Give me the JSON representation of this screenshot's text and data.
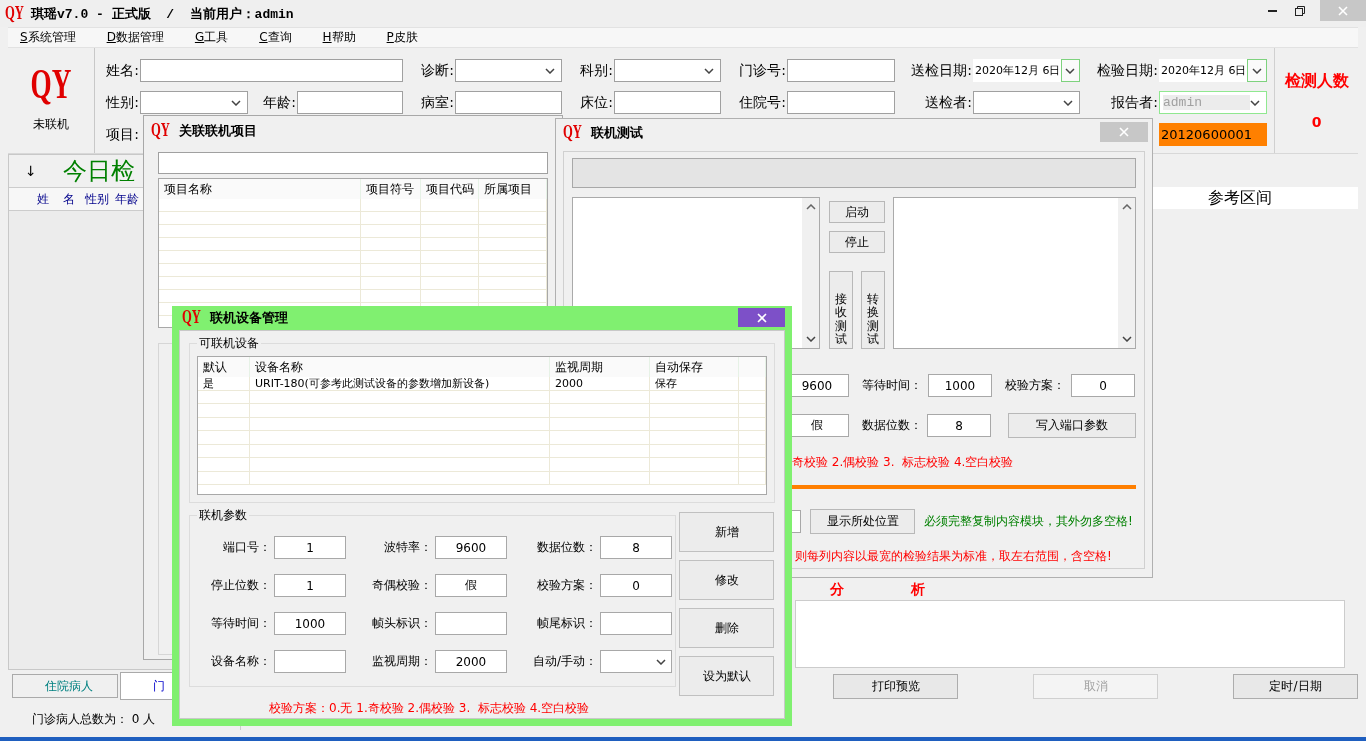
{
  "window": {
    "logo": "QY",
    "title": "琪瑶v7.0 - 正式版  /  当前用户：admin"
  },
  "menu": [
    {
      "key": "S",
      "label": "系统管理"
    },
    {
      "key": "D",
      "label": "数据管理"
    },
    {
      "key": "G",
      "label": "工具"
    },
    {
      "key": "C",
      "label": "查询"
    },
    {
      "key": "H",
      "label": "帮助"
    },
    {
      "key": "P",
      "label": "皮肤"
    }
  ],
  "header": {
    "logo": "QY",
    "connection": "未联机",
    "form": [
      {
        "label": "姓名:",
        "kind": "text"
      },
      {
        "label": "诊断:",
        "kind": "combo"
      },
      {
        "label": "科别:",
        "kind": "combo"
      },
      {
        "label": "门诊号:",
        "kind": "text"
      },
      {
        "label": "送检日期:",
        "kind": "date",
        "value": "2020年12月 6日"
      },
      {
        "label": "检验日期:",
        "kind": "date",
        "value": "2020年12月 6日"
      },
      {
        "label": "性别:",
        "kind": "combo"
      },
      {
        "label": "年龄:",
        "kind": "text"
      },
      {
        "label": "病室:",
        "kind": "text"
      },
      {
        "label": "床位:",
        "kind": "text"
      },
      {
        "label": "住院号:",
        "kind": "text"
      },
      {
        "label": "送检者:",
        "kind": "combo"
      },
      {
        "label": "报告者:",
        "kind": "combo",
        "value": "admin",
        "disabled": true
      }
    ],
    "item_label": "项目:",
    "sample_no": "20120600001",
    "count_label": "检测人数",
    "count": "0"
  },
  "patients": {
    "arrow": "↓",
    "title": "今日检",
    "columns": [
      "姓 名",
      "性别",
      "年龄"
    ]
  },
  "results": {
    "columns": [
      "参考区间"
    ],
    "analysis_title": "分 析"
  },
  "bottom_tabs": [
    {
      "label": "住院病人",
      "selected": false
    },
    {
      "label": "门",
      "selected": true
    }
  ],
  "buttons": [
    {
      "label": "打印预览",
      "disabled": false
    },
    {
      "label": "取消",
      "disabled": true
    },
    {
      "label": "定时/日期",
      "disabled": false
    }
  ],
  "status_bar": "门诊病人总数为： 0 人",
  "item_dialog": {
    "logo": "QY",
    "title": "关联联机项目",
    "columns": [
      "项目名称",
      "项目符号",
      "项目代码",
      "所属项目"
    ]
  },
  "test_dialog": {
    "logo": "QY",
    "title": "联机测试",
    "side_buttons": [
      "启动",
      "停止"
    ],
    "vertical_buttons": [
      "接收测试",
      "转换测试"
    ],
    "rows": [
      [
        {
          "kind": "field",
          "value": "9600"
        },
        {
          "kind": "label",
          "text": "等待时间："
        },
        {
          "kind": "field",
          "value": "1000"
        },
        {
          "kind": "label",
          "text": "校验方案："
        },
        {
          "kind": "field",
          "value": "0"
        }
      ],
      [
        {
          "kind": "field",
          "value": "假"
        },
        {
          "kind": "label",
          "text": "数据位数："
        },
        {
          "kind": "field",
          "value": "8"
        },
        {
          "kind": "button",
          "text": "写入端口参数"
        }
      ]
    ],
    "parity_note": "奇校验 2.偶校验 3.  标志校验 4.空白校验",
    "locate_button": "显示所处位置",
    "copy_note": "必须完整复制内容模块，其外勿多空格!",
    "range_note": "则每列内容以最宽的检验结果为标准，取左右范围，含空格!"
  },
  "device_dialog": {
    "logo": "QY",
    "title": "联机设备管理",
    "devices_group": "可联机设备",
    "columns": [
      "默认",
      "设备名称",
      "监视周期",
      "自动保存"
    ],
    "rows": [
      [
        "是",
        "URIT-180(可参考此测试设备的参数增加新设备)",
        "2000",
        "保存"
      ]
    ],
    "params_group": "联机参数",
    "params": [
      {
        "label": "端口号：",
        "kind": "text",
        "value": "1"
      },
      {
        "label": "波特率：",
        "kind": "text",
        "value": "9600"
      },
      {
        "label": "数据位数：",
        "kind": "text",
        "value": "8"
      },
      {
        "label": "停止位数：",
        "kind": "text",
        "value": "1"
      },
      {
        "label": "奇偶校验：",
        "kind": "text",
        "value": "假"
      },
      {
        "label": "校验方案：",
        "kind": "text",
        "value": "0"
      },
      {
        "label": "等待时间：",
        "kind": "text",
        "value": "1000"
      },
      {
        "label": "帧头标识：",
        "kind": "text"
      },
      {
        "label": "帧尾标识：",
        "kind": "text"
      },
      {
        "label": "设备名称：",
        "kind": "text"
      },
      {
        "label": "监视周期：",
        "kind": "text",
        "value": "2000"
      },
      {
        "label": "自动/手动：",
        "kind": "combo"
      }
    ],
    "buttons": [
      "新增",
      "修改",
      "删除",
      "设为默认"
    ],
    "note": "校验方案：0.无 1.奇校验 2.偶校验 3.  标志校验 4.空白校验"
  }
}
